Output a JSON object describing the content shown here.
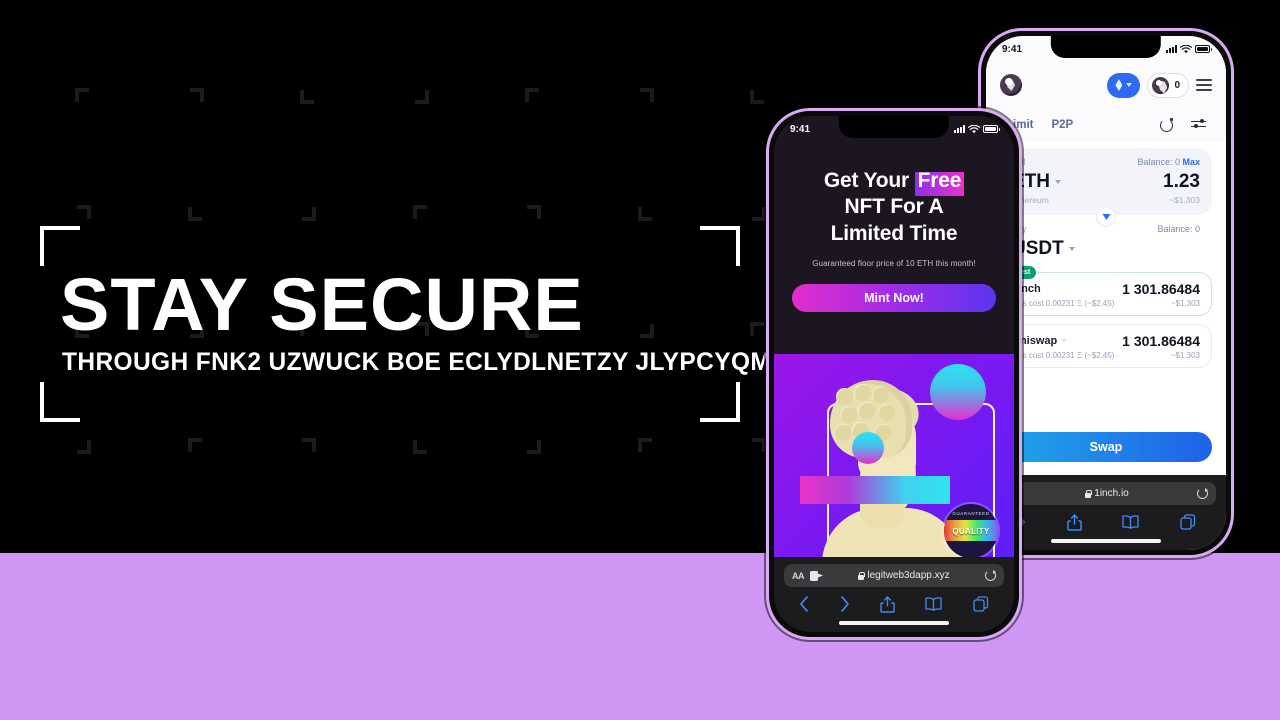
{
  "slide": {
    "headline": "STAY SECURE",
    "subhead": "THROUGH FNK2 UZWUCK BOE ECLYDLNETZY JLYPCYQM",
    "background_color": "#000000",
    "band_color": "#cf96f4",
    "frame_color": "#ffffff"
  },
  "front_phone": {
    "frame_color": "#d9a9f2",
    "status": {
      "time": "9:41",
      "signal_icon": "cellular-bars-icon",
      "wifi_icon": "wifi-icon",
      "battery_icon": "battery-icon"
    },
    "promo": {
      "title_line1_a": "Get Your ",
      "title_line1_hl": "Free",
      "title_line2": "NFT For A",
      "title_line3": "Limited Time",
      "subtitle": "Guaranteed floor price of 10 ETH this month!",
      "cta_label": "Mint Now!",
      "cta_gradient_from": "#e22ecb",
      "cta_gradient_to": "#5b35f0"
    },
    "artwork": {
      "alt_name": "vaporwave-classical-bust",
      "badge_top_text": "GUARANTEED",
      "badge_text": "QUALITY"
    },
    "browser": {
      "url": "legitweb3dapp.xyz",
      "reader_label": "AA",
      "extension_icon": "puzzle-extension-icon",
      "lock_icon": "lock-icon",
      "reload_icon": "reload-icon",
      "back_icon": "chevron-left-icon",
      "forward_icon": "chevron-right-icon",
      "share_icon": "share-icon",
      "bookmarks_icon": "book-icon",
      "tabs_icon": "tabs-icon"
    }
  },
  "back_phone": {
    "frame_color": "#d9a9f2",
    "status": {
      "time": "9:41",
      "signal_icon": "cellular-bars-icon",
      "wifi_icon": "wifi-icon",
      "battery_icon": "battery-icon"
    },
    "header": {
      "logo_icon": "unicorn-logo-icon",
      "chain_label": "",
      "chain_icon": "ethereum-diamond-icon",
      "chain_chevron_icon": "chevron-down-icon",
      "wallet_count": "0",
      "wallet_icon": "unicorn-logo-icon",
      "menu_icon": "hamburger-menu-icon"
    },
    "tabs": [
      {
        "label": "Limit"
      },
      {
        "label": "P2P"
      }
    ],
    "tab_actions": {
      "refresh_icon": "refresh-icon",
      "settings_icon": "sliders-icon"
    },
    "sell": {
      "label": "sell",
      "balance": "Balance: 0",
      "max_label": "Max",
      "token": "ETH",
      "token_chevron_icon": "chevron-down-icon",
      "amount": "1.23",
      "network": "Ethereum",
      "usd": "~$1,303"
    },
    "switch_icon": "swap-direction-arrow-icon",
    "buy": {
      "label": "buy",
      "balance": "Balance: 0",
      "token": "USDT",
      "token_chevron_icon": "chevron-down-icon"
    },
    "quotes": [
      {
        "badge": "Best",
        "name": "1inch",
        "amount": "1 301.86484",
        "gas": "Gas cost 0.00231 Ξ (~$2.45)",
        "usd": "~$1,303",
        "has_chevron": false
      },
      {
        "badge": "",
        "name": "Uniswap",
        "amount": "1 301.86484",
        "gas": "Gas cost 0.00231 Ξ (~$2.45)",
        "usd": "~$1,303",
        "has_chevron": true
      }
    ],
    "swap_button": {
      "label": "Swap",
      "gradient_from": "#21a6e8",
      "gradient_to": "#2061e8"
    },
    "browser": {
      "url": "1inch.io",
      "extension_icon": "puzzle-extension-icon",
      "lock_icon": "lock-icon",
      "reload_icon": "reload-icon",
      "forward_icon": "chevron-right-icon",
      "share_icon": "share-icon",
      "bookmarks_icon": "book-icon",
      "tabs_icon": "tabs-icon"
    }
  }
}
